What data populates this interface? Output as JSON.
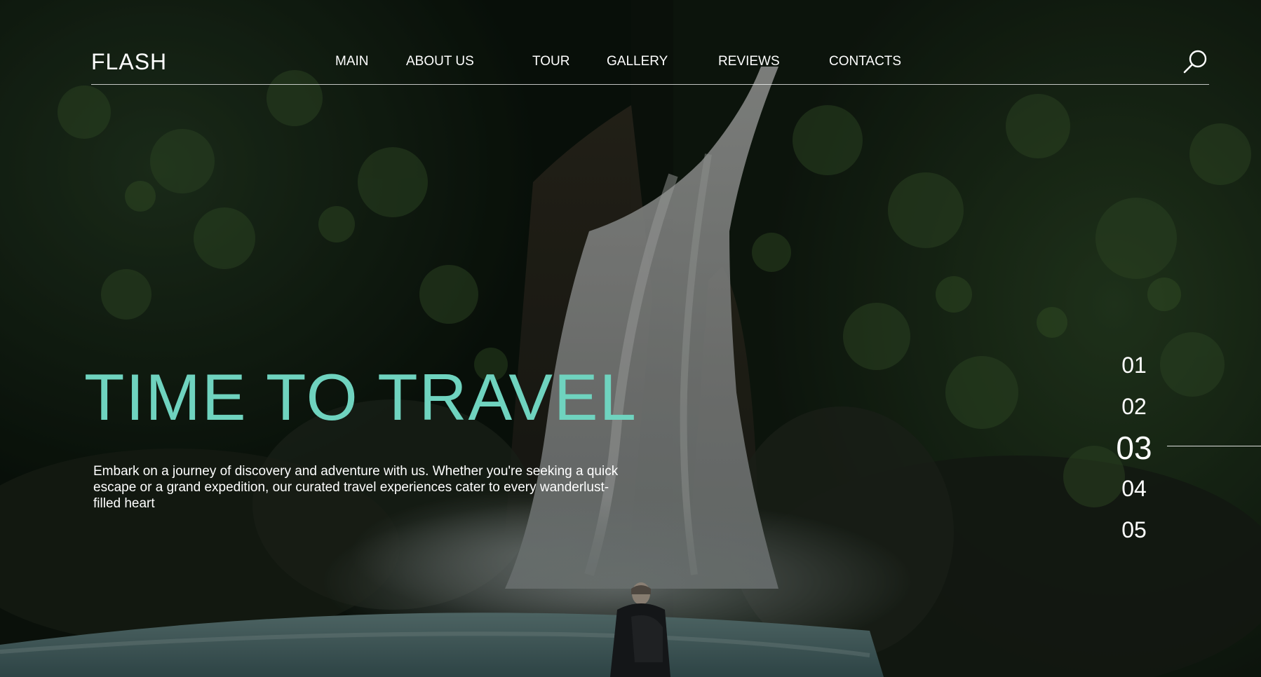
{
  "header": {
    "logo": "FLASH",
    "nav": [
      "MAIN",
      "ABOUT US",
      "TOUR",
      "GALLERY",
      "REVIEWS",
      "CONTACTS"
    ]
  },
  "hero": {
    "title": "TIME TO TRAVEL",
    "description": "Embark on a journey of discovery and adventure with us. Whether you're seeking a quick escape or a grand expedition, our curated travel experiences cater to every wanderlust-filled heart"
  },
  "pagination": {
    "pages": [
      "01",
      "02",
      "03",
      "04",
      "05"
    ],
    "active": "03"
  },
  "colors": {
    "accent": "#6fd3bf",
    "text": "#ffffff"
  },
  "icons": {
    "search": "search-icon"
  }
}
